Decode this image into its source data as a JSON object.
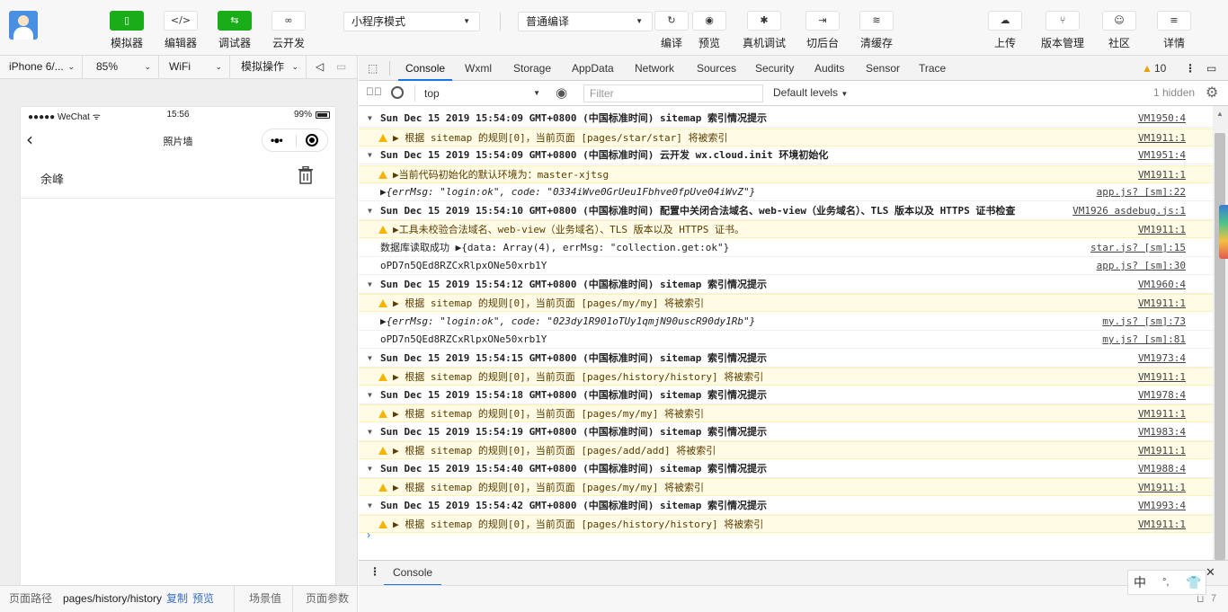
{
  "toolbar": {
    "buttons": [
      {
        "label": "模拟器",
        "glyph": "▯"
      },
      {
        "label": "编辑器",
        "glyph": "</>"
      },
      {
        "label": "调试器",
        "glyph": "⇆"
      },
      {
        "label": "云开发",
        "glyph": "∞"
      }
    ],
    "mode_select": "小程序模式",
    "compile_select": "普通编译",
    "actions": [
      {
        "label": "编译",
        "glyph": "↻"
      },
      {
        "label": "预览",
        "glyph": "◉"
      },
      {
        "label": "真机调试",
        "glyph": "✱"
      },
      {
        "label": "切后台",
        "glyph": "⇥"
      },
      {
        "label": "清缓存",
        "glyph": "≋"
      }
    ],
    "right_actions": [
      {
        "label": "上传",
        "glyph": "☁"
      },
      {
        "label": "版本管理",
        "glyph": "⑂"
      },
      {
        "label": "社区",
        "glyph": "☺"
      },
      {
        "label": "详情",
        "glyph": "≡"
      }
    ]
  },
  "simulator": {
    "device": "iPhone 6/...",
    "zoom": "85%",
    "network": "WiFi",
    "ops": "模拟操作",
    "phone": {
      "carrier": "●●●●● WeChat ᯤ",
      "time": "15:56",
      "battery": "99%",
      "nav_title": "照片墙",
      "capsule_dots": "•●•",
      "row_name": "余峰"
    }
  },
  "pathbar": {
    "label": "页面路径",
    "path": "pages/history/history",
    "copy": "复制",
    "preview": "预览",
    "scene": "场景值",
    "params": "页面参数"
  },
  "devtools": {
    "tabs": [
      "Console",
      "Wxml",
      "Storage",
      "AppData",
      "Network",
      "Sources",
      "Security",
      "Audits",
      "Sensor",
      "Trace"
    ],
    "warning_count": "10",
    "context": "top",
    "filter_placeholder": "Filter",
    "levels": "Default levels",
    "hidden": "1 hidden",
    "drawer_tab": "Console",
    "status_count": "7"
  },
  "console_rows": [
    {
      "type": "group",
      "text": "Sun Dec 15 2019 15:54:09 GMT+0800 (中国标准时间) sitemap 索引情况提示",
      "src": "VM1950:4"
    },
    {
      "type": "warn",
      "text": "▶ 根据 sitemap 的规则[0]，当前页面 [pages/star/star] 将被索引",
      "src": "VM1911:1"
    },
    {
      "type": "group",
      "text": "Sun Dec 15 2019 15:54:09 GMT+0800 (中国标准时间) 云开发 wx.cloud.init 环境初始化",
      "src": "VM1951:4"
    },
    {
      "type": "warn",
      "text": "▶当前代码初始化的默认环境为：master-xjtsg",
      "src": "VM1911:1"
    },
    {
      "type": "obj",
      "text": "▶{errMsg: \"login:ok\", code: \"0334iWve0GrUeu1Fbhve0fpUve04iWvZ\"}",
      "src": "app.js? [sm]:22"
    },
    {
      "type": "group",
      "text": "Sun Dec 15 2019 15:54:10 GMT+0800 (中国标准时间) 配置中关闭合法域名、web-view（业务域名）、TLS 版本以及 HTTPS 证书检查",
      "src": "VM1926 asdebug.js:1"
    },
    {
      "type": "warn",
      "text": "▶工具未校验合法域名、web-view（业务域名）、TLS 版本以及 HTTPS 证书。",
      "src": "VM1911:1"
    },
    {
      "type": "log",
      "text": "数据库读取成功 ▶{data: Array(4), errMsg: \"collection.get:ok\"}",
      "src": "star.js? [sm]:15"
    },
    {
      "type": "log",
      "text": "oPD7n5QEd8RZCxRlpxONe50xrb1Y",
      "src": "app.js? [sm]:30"
    },
    {
      "type": "group",
      "text": "Sun Dec 15 2019 15:54:12 GMT+0800 (中国标准时间) sitemap 索引情况提示",
      "src": "VM1960:4"
    },
    {
      "type": "warn",
      "text": "▶ 根据 sitemap 的规则[0]，当前页面 [pages/my/my] 将被索引",
      "src": "VM1911:1"
    },
    {
      "type": "obj",
      "text": "▶{errMsg: \"login:ok\", code: \"023dy1R901oTUy1qmjN90uscR90dy1Rb\"}",
      "src": "my.js? [sm]:73"
    },
    {
      "type": "log",
      "text": "oPD7n5QEd8RZCxRlpxONe50xrb1Y",
      "src": "my.js? [sm]:81"
    },
    {
      "type": "group",
      "text": "Sun Dec 15 2019 15:54:15 GMT+0800 (中国标准时间) sitemap 索引情况提示",
      "src": "VM1973:4"
    },
    {
      "type": "warn",
      "text": "▶ 根据 sitemap 的规则[0]，当前页面 [pages/history/history] 将被索引",
      "src": "VM1911:1"
    },
    {
      "type": "group",
      "text": "Sun Dec 15 2019 15:54:18 GMT+0800 (中国标准时间) sitemap 索引情况提示",
      "src": "VM1978:4"
    },
    {
      "type": "warn",
      "text": "▶ 根据 sitemap 的规则[0]，当前页面 [pages/my/my] 将被索引",
      "src": "VM1911:1"
    },
    {
      "type": "group",
      "text": "Sun Dec 15 2019 15:54:19 GMT+0800 (中国标准时间) sitemap 索引情况提示",
      "src": "VM1983:4"
    },
    {
      "type": "warn",
      "text": "▶ 根据 sitemap 的规则[0]，当前页面 [pages/add/add] 将被索引",
      "src": "VM1911:1"
    },
    {
      "type": "group",
      "text": "Sun Dec 15 2019 15:54:40 GMT+0800 (中国标准时间) sitemap 索引情况提示",
      "src": "VM1988:4"
    },
    {
      "type": "warn",
      "text": "▶ 根据 sitemap 的规则[0]，当前页面 [pages/my/my] 将被索引",
      "src": "VM1911:1"
    },
    {
      "type": "group",
      "text": "Sun Dec 15 2019 15:54:42 GMT+0800 (中国标准时间) sitemap 索引情况提示",
      "src": "VM1993:4"
    },
    {
      "type": "warn",
      "text": "▶ 根据 sitemap 的规则[0]，当前页面 [pages/history/history] 将被索引",
      "src": "VM1911:1"
    }
  ],
  "ime": {
    "lang": "中",
    "punct": "°,",
    "skin": "👕"
  },
  "colors": {
    "accent": "#1aad19",
    "tab_active": "#1a73e8",
    "warn_bg": "#fffbe5"
  }
}
